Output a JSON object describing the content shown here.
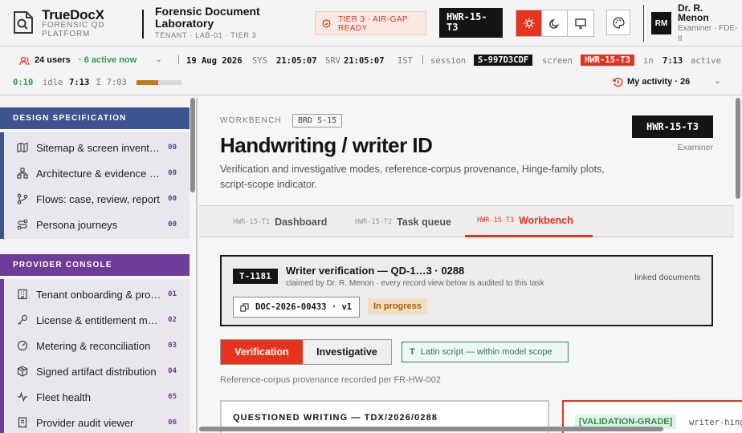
{
  "brand": {
    "title": "TrueDocX",
    "subtitle": "FORENSIC QD PLATFORM"
  },
  "lab": {
    "title": "Forensic Document Laboratory",
    "subtitle": "TENANT · LAB-01 · TIER 3"
  },
  "tier_badge": "TIER 3 · AIR-GAP READY",
  "screen_chip": "HWR-15-T3",
  "user": {
    "initials": "RM",
    "name": "Dr. R. Menon",
    "role": "Examiner · FDE-II"
  },
  "status": {
    "users_count": "24 users",
    "active_now": "· 6 active now",
    "date": "19 Aug 2026",
    "sys_label": "SYS",
    "sys_time": "21:05:07",
    "srv_label": "SRV",
    "srv_time": "21:05:07",
    "tz": "IST",
    "session_label": "session",
    "session_id": "S-997D3CDF",
    "screen_label": "screen",
    "screen_id": "HWR-15-T3",
    "in_label": "in",
    "in_time": "7:13",
    "active_label": "active",
    "active_time": "0:10",
    "idle_label": "idle",
    "idle_time": "7:13",
    "sum_time": "Σ 7:03",
    "idle_fraction": 0.48,
    "my_activity": "My activity · 26"
  },
  "sidebar": {
    "design_head": "DESIGN SPECIFICATION",
    "design_items": [
      {
        "label": "Sitemap & screen inventory",
        "num": "00"
      },
      {
        "label": "Architecture & evidence s...",
        "num": "00"
      },
      {
        "label": "Flows: case, review, report",
        "num": "00"
      },
      {
        "label": "Persona journeys",
        "num": "00"
      }
    ],
    "provider_head": "PROVIDER CONSOLE",
    "provider_items": [
      {
        "label": "Tenant onboarding & prov...",
        "num": "01"
      },
      {
        "label": "License & entitlement ma...",
        "num": "02"
      },
      {
        "label": "Metering & reconciliation",
        "num": "03"
      },
      {
        "label": "Signed artifact distribution",
        "num": "04"
      },
      {
        "label": "Fleet health",
        "num": "05"
      },
      {
        "label": "Provider audit viewer",
        "num": "06"
      }
    ]
  },
  "page": {
    "crumb": "WORKBENCH",
    "brd": "BRD S-15",
    "title": "Handwriting / writer ID",
    "description": "Verification and investigative modes, reference-corpus provenance, Hinge-family plots, script-scope indicator.",
    "examiner_chip": "HWR-15-T3",
    "examiner_label": "Examiner"
  },
  "tabs": [
    {
      "code": "HWR-15-T1",
      "label": "Dashboard"
    },
    {
      "code": "HWR-15-T2",
      "label": "Task queue"
    },
    {
      "code": "HWR-15-T3",
      "label": "Workbench"
    }
  ],
  "task": {
    "id": "T-1181",
    "title": "Writer verification — QD-1…3 · 0288",
    "subtitle": "claimed by Dr. R. Menon · every record view below is audited to this task",
    "linked": "linked documents",
    "doc": "DOC-2026-00433 · v1",
    "status": "In progress"
  },
  "modes": {
    "verification": "Verification",
    "investigative": "Investigative"
  },
  "scope_chip": "Latin script — within model scope",
  "provenance_note": "Reference-corpus provenance recorded per FR-HW-002",
  "questioned_title": "QUESTIONED WRITING — TDX/2026/0288",
  "validation_badge": "[VALIDATION-GRADE]",
  "validation_text": "writer-hinge",
  "colors": {
    "accent": "#e6331e",
    "design_head": "#3d5491",
    "provider_head": "#6f3c99",
    "progress": "#c67a14"
  }
}
